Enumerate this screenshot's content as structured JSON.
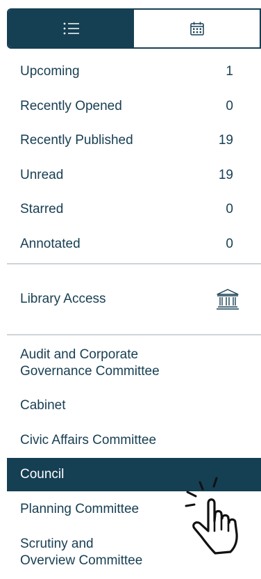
{
  "tabs": [
    {
      "name": "list-view",
      "icon": "list-icon",
      "active": true
    },
    {
      "name": "calendar-view",
      "icon": "calendar-icon",
      "active": false
    }
  ],
  "smart_lists": [
    {
      "label": "Upcoming",
      "count": "1"
    },
    {
      "label": "Recently Opened",
      "count": "0"
    },
    {
      "label": "Recently Published",
      "count": "19"
    },
    {
      "label": "Unread",
      "count": "19"
    },
    {
      "label": "Starred",
      "count": "0"
    },
    {
      "label": "Annotated",
      "count": "0"
    }
  ],
  "library": {
    "label": "Library Access",
    "icon": "library-icon"
  },
  "committees": [
    {
      "label_lines": [
        "Audit and Corporate",
        "Governance Committee"
      ]
    },
    {
      "label_lines": [
        "Cabinet"
      ]
    },
    {
      "label_lines": [
        "Civic Affairs Committee"
      ]
    },
    {
      "label_lines": [
        "Council"
      ],
      "selected": true
    },
    {
      "label_lines": [
        "Planning Committee"
      ]
    },
    {
      "label_lines": [
        "Scrutiny and",
        "Overview Committee"
      ]
    }
  ],
  "colors": {
    "accent": "#153f53",
    "text": "#173e52",
    "divider": "#cfd3d6"
  },
  "overlay_icon": "tap-hand-icon"
}
